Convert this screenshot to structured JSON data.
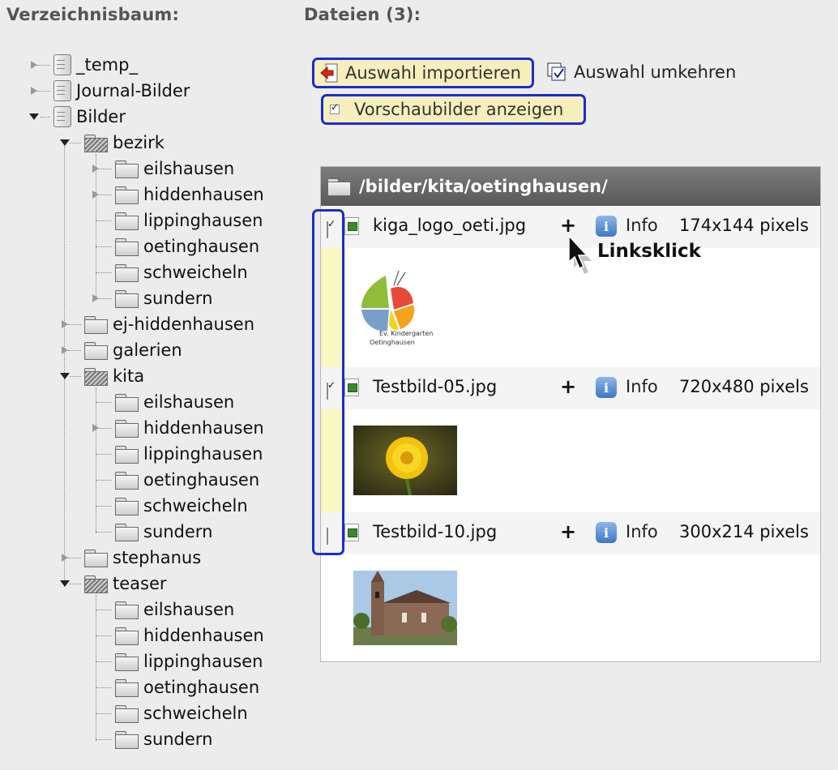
{
  "left_heading": "Verzeichnisbaum:",
  "right_heading": "Dateien (3):",
  "tree": {
    "roots": [
      "_temp_",
      "Journal-Bilder",
      "Bilder"
    ],
    "bilder_children": [
      "bezirk",
      "ej-hiddenhausen",
      "galerien",
      "kita",
      "stephanus",
      "teaser"
    ],
    "bezirk_children": [
      "eilshausen",
      "hiddenhausen",
      "lippinghausen",
      "oetinghausen",
      "schweicheln",
      "sundern"
    ],
    "kita_children": [
      "eilshausen",
      "hiddenhausen",
      "lippinghausen",
      "oetinghausen",
      "schweicheln",
      "sundern"
    ],
    "teaser_children": [
      "eilshausen",
      "hiddenhausen",
      "lippinghausen",
      "oetinghausen",
      "schweicheln",
      "sundern"
    ]
  },
  "toolbar": {
    "import_label": "Auswahl importieren",
    "invert_label": "Auswahl umkehren",
    "preview_label": "Vorschaubilder anzeigen",
    "preview_checked": true
  },
  "file_panel": {
    "path": "/bilder/kita/oetinghausen/",
    "files": [
      {
        "name": "kiga_logo_oeti.jpg",
        "info": "Info",
        "dims": "174x144 pixels",
        "checked": true
      },
      {
        "name": "Testbild-05.jpg",
        "info": "Info",
        "dims": "720x480 pixels",
        "checked": true
      },
      {
        "name": "Testbild-10.jpg",
        "info": "Info",
        "dims": "300x214 pixels",
        "checked": false
      }
    ],
    "plus_symbol": "+"
  },
  "annotation": {
    "callout": "Linksklick"
  },
  "colors": {
    "highlight_border": "#1b2ccf",
    "button_bg": "#f6efbc",
    "panel_header": "#6b6b6b",
    "page_bg": "#ececec"
  }
}
